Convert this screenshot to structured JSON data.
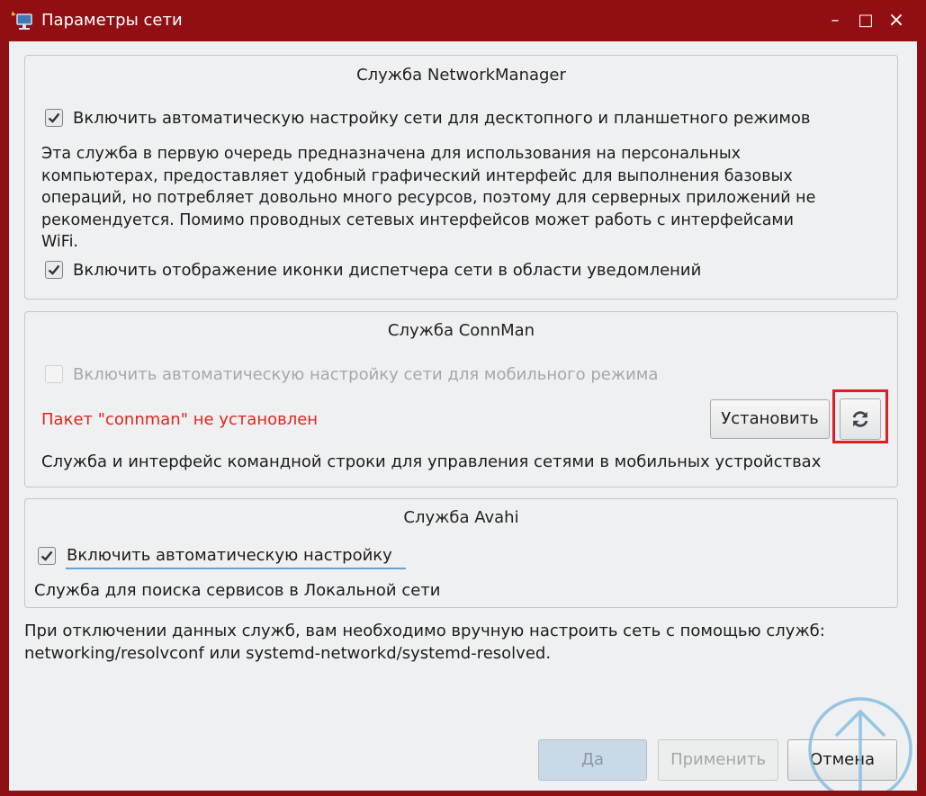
{
  "window": {
    "title": "Параметры сети",
    "minimize": "–",
    "maximize": "□",
    "close": "×"
  },
  "network_manager": {
    "title": "Служба NetworkManager",
    "auto_label": "Включить автоматическую настройку сети для десктопного и планшетного режимов",
    "auto_checked": true,
    "description_lines": [
      "Эта служба в первую очередь предназначена для использования на персональных",
      "компьютерах,  предоставляет удобный графический интерфейс для выполнения базовых",
      "операций, но потребляет довольно много ресурсов, поэтому для серверных приложений не",
      "рекомендуется. Помимо проводных сетевых интерфейсов может работь с интерфейсами",
      "WiFi."
    ],
    "tray_label": "Включить отображение иконки диспетчера сети в области уведомлений",
    "tray_checked": true
  },
  "connman": {
    "title": "Служба ConnMan",
    "auto_label": "Включить автоматическую настройку сети для мобильного режима",
    "auto_checked": false,
    "status": "Пакет \"connman\" не установлен",
    "install_label": "Установить",
    "refresh_icon": "refresh-icon",
    "description": "Служба и интерфейс командной строки для управления сетями в мобильных устройствах"
  },
  "avahi": {
    "title": "Служба Avahi",
    "auto_label": "Включить автоматическую настройку",
    "auto_checked": true,
    "description": "Служба для поиска сервисов в Локальной сети"
  },
  "note_lines": [
    "При отключении данных служб, вам необходимо вручную настроить сеть с помощью служб:",
    "networking/resolvconf или systemd-networkd/systemd-resolved."
  ],
  "buttons": {
    "ok": "Да",
    "apply": "Применить",
    "cancel": "Отмена"
  },
  "colors": {
    "titlebar": "#910f13",
    "error": "#e3241b",
    "highlight": "#e01b24",
    "focus": "#5ea6d7"
  }
}
